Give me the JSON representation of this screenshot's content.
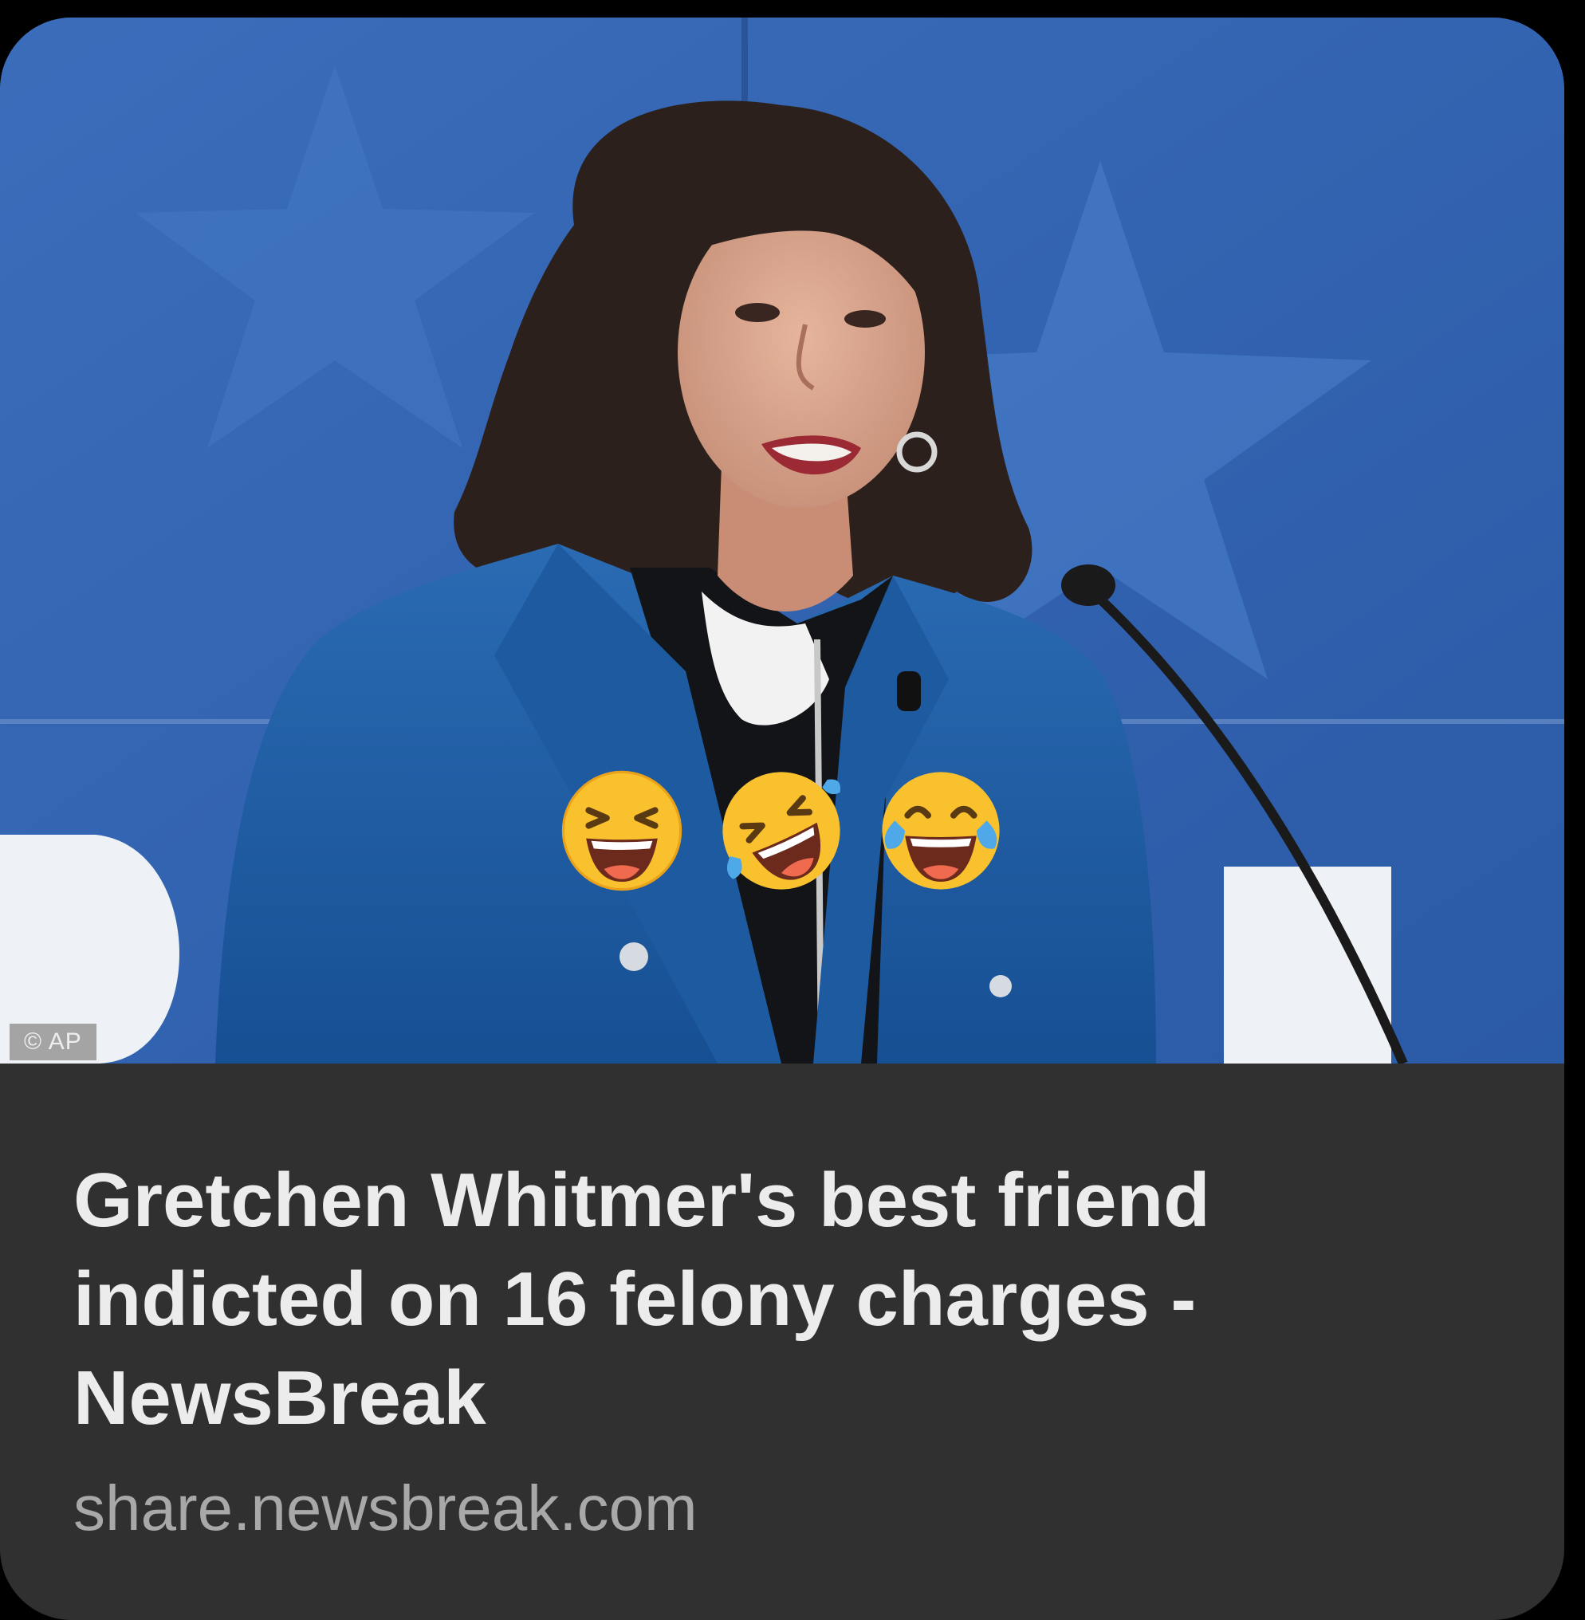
{
  "card": {
    "image": {
      "credit": "© AP",
      "emojis": [
        "laughing-emoji",
        "rolling-on-floor-laughing-emoji",
        "tears-of-joy-emoji"
      ]
    },
    "headline": "Gretchen Whitmer's best friend indicted on 16 felony charges - NewsBreak",
    "domain": "share.newsbreak.com"
  },
  "colors": {
    "background": "#000000",
    "card": "#303030",
    "headline": "#ececec",
    "domain": "#a8a8a8",
    "photo_backdrop": "#2f5fae",
    "blazer": "#1f5ea6"
  }
}
